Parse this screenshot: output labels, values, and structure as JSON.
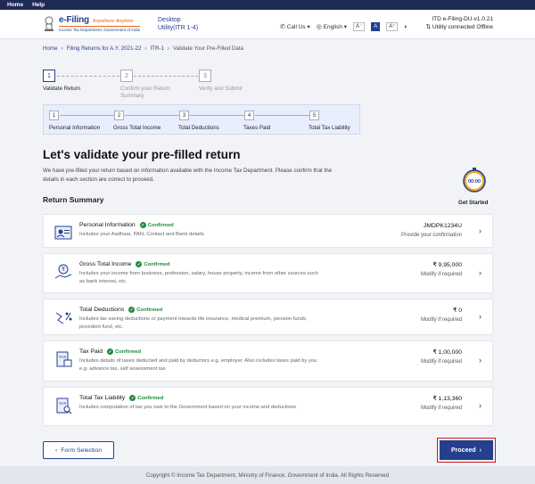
{
  "topnav": [
    "Home",
    "Help"
  ],
  "header": {
    "logo_main": "e-Filing",
    "logo_tag": "Anywhere Anytime",
    "logo_sub": "Income Tax Department, Government of India",
    "utility_line1": "Desktop",
    "utility_line2": "Utility(ITR 1-4)",
    "call_us": "Call Us",
    "language": "English",
    "font_small": "A⁻",
    "font_normal": "A",
    "font_large": "A⁺",
    "version": "ITD e-Filing-DU-v1.0.21",
    "status": "Utility connected Offline"
  },
  "breadcrumb": [
    "Home",
    "Filing Returns for A.Y. 2021-22",
    "ITR-1",
    "Validate Your Pre-Filled Data"
  ],
  "steps": [
    {
      "num": "1",
      "label": "Validate Return"
    },
    {
      "num": "2",
      "label": "Confirm your Return Summary"
    },
    {
      "num": "3",
      "label": "Verify and Submit"
    }
  ],
  "substeps": [
    {
      "num": "1",
      "label": "Personal Information"
    },
    {
      "num": "2",
      "label": "Gross Total Income"
    },
    {
      "num": "3",
      "label": "Total Deductions"
    },
    {
      "num": "4",
      "label": "Taxes Paid"
    },
    {
      "num": "5",
      "label": "Total Tax Liability"
    }
  ],
  "page": {
    "title": "Let's validate your pre-filled return",
    "description": "We have pre-filled your return based on information available with the Income Tax Department. Please confirm that the details in each section are correct to proceed.",
    "section_title": "Return Summary",
    "get_started": "Get Started",
    "timer_text": "00:00"
  },
  "cards": [
    {
      "title": "Personal Information",
      "status": "Confirmed",
      "desc": "Includes your Aadhaar, PAN, Contact and Bank details",
      "value": "JMDPK1234U",
      "value_sub": "Provide your confirmation"
    },
    {
      "title": "Gross Total Income",
      "status": "Confirmed",
      "desc": "Includes your income from business, profession, salary, house property, income from other sources such as bank interest, etc.",
      "value": "₹ 9,95,000",
      "value_sub": "Modify if required"
    },
    {
      "title": "Total Deductions",
      "status": "Confirmed",
      "desc": "Includes tax saving deductions or payment towards life insurance, medical premium, pension funds, provident fund, etc.",
      "value": "₹ 0",
      "value_sub": "Modify if required"
    },
    {
      "title": "Tax Paid",
      "status": "Confirmed",
      "desc": "Includes details of taxes deducted and paid by deductors e.g. employer. Also includes taxes paid by you e.g. advance tax, self assessment tax",
      "value": "₹ 1,00,000",
      "value_sub": "Modify if required"
    },
    {
      "title": "Total Tax Liability",
      "status": "Confirmed",
      "desc": "Includes computation of tax you owe to the Government based on your income and deductions",
      "value": "₹ 1,13,360",
      "value_sub": "Modify if required"
    }
  ],
  "buttons": {
    "back": "Form Selection",
    "proceed": "Proceed"
  },
  "footer": "Copyright © Income Tax Department, Ministry of Finance, Government of India. All Rights Reserved",
  "colors": {
    "primary": "#253f8e",
    "success": "#1e8a3c",
    "highlight": "#d3161b",
    "accent": "#e26a1d"
  }
}
